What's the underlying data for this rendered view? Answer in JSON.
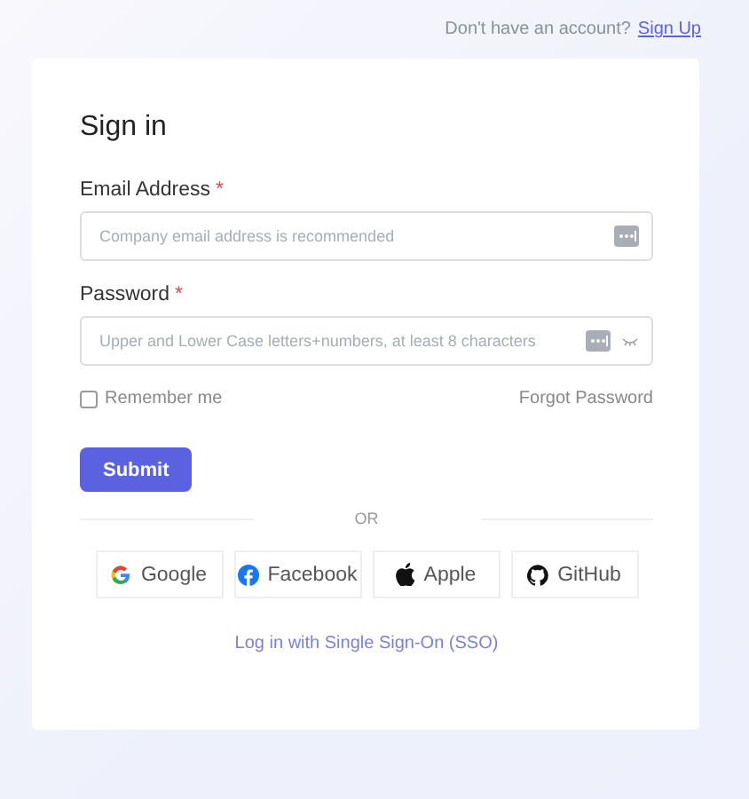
{
  "header": {
    "prompt": "Don't have an account?",
    "link": "Sign Up"
  },
  "form": {
    "title": "Sign in",
    "fields": [
      {
        "kind": "email",
        "label": "Email Address",
        "required_mark": "*",
        "placeholder": "Company email address is recommended"
      },
      {
        "kind": "password",
        "label": "Password",
        "required_mark": "*",
        "placeholder": "Upper and Lower Case letters+numbers, at least 8 characters"
      }
    ],
    "remember": {
      "label": "Remember me",
      "checked": false
    },
    "forgot": "Forgot Password",
    "submit": "Submit",
    "divider": "OR",
    "providers": [
      {
        "kind": "google",
        "label": "Google"
      },
      {
        "kind": "facebook",
        "label": "Facebook"
      },
      {
        "kind": "apple",
        "label": "Apple"
      },
      {
        "kind": "github",
        "label": "GitHub"
      }
    ],
    "sso": "Log in with Single Sign-On (SSO)"
  }
}
